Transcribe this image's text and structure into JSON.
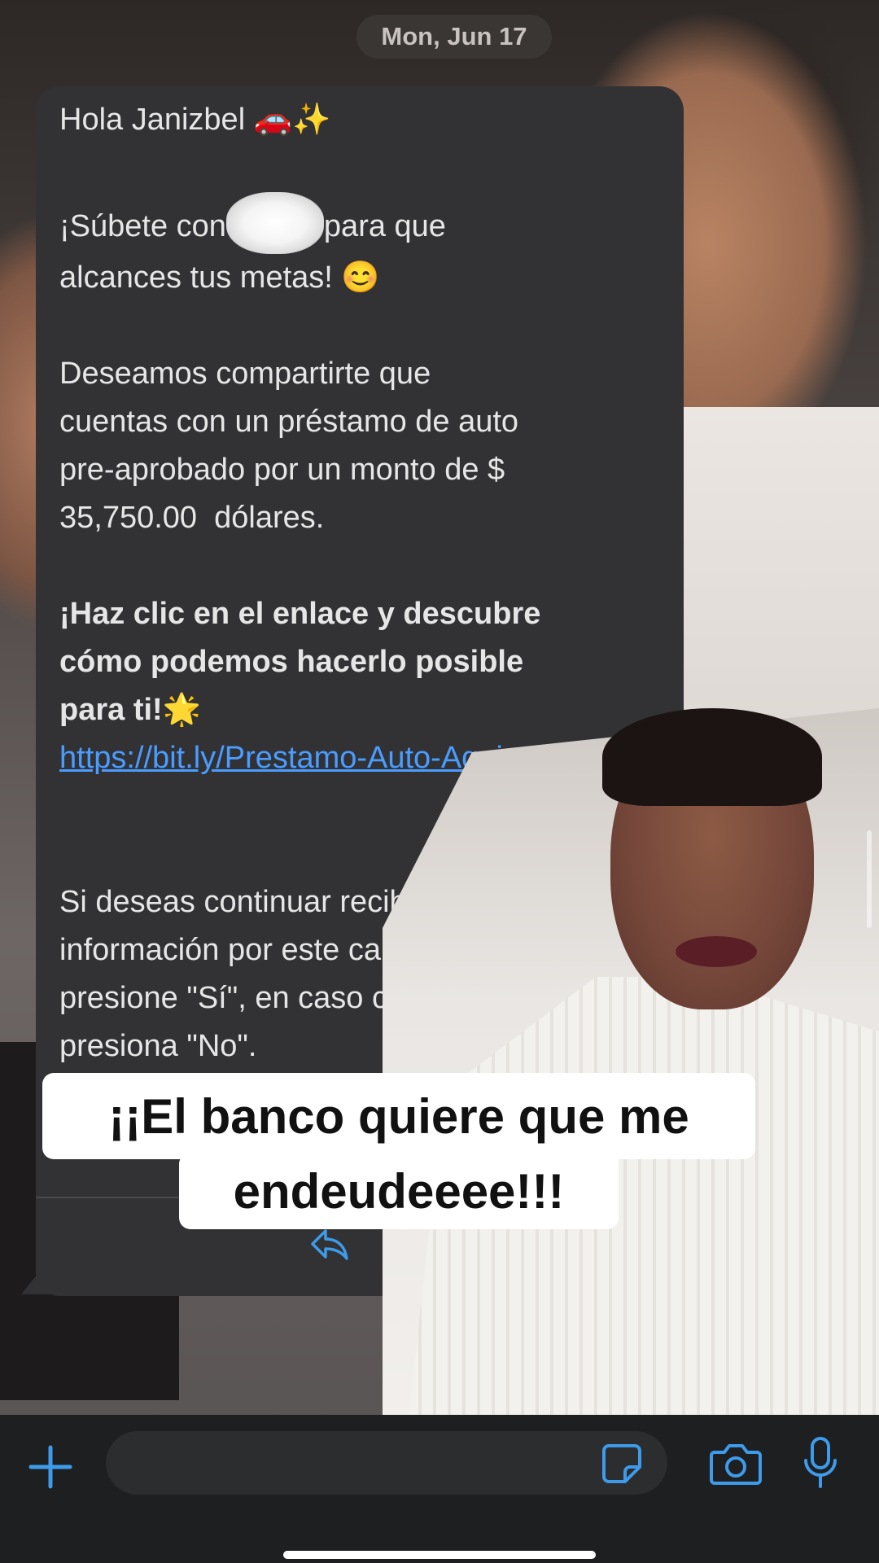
{
  "date_label": "Mon, Jun 17",
  "message": {
    "greeting": "Hola Janizbel 🚗✨",
    "line1_before": "¡Súbete con",
    "line1_after": "para que",
    "line2": "alcances tus metas! 😊",
    "para2_l1": "Deseamos compartirte que",
    "para2_l2": "cuentas con un préstamo de auto",
    "para2_l3": "pre-aprobado por un monto de $",
    "para2_l4": "35,750.00  dólares.",
    "cta_l1": "¡Haz clic en el enlace y descubre",
    "cta_l2": "cómo podemos hacerlo posible",
    "cta_l3": "para ti!🌟",
    "link": "https://bit.ly/Prestamo-Auto-Aqui",
    "para4_l1": "Si deseas continuar recibiendo",
    "para4_l2": "información por este canal",
    "para4_l3": "presione \"Sí\", en caso contrario",
    "para4_l4": "presiona \"No\"."
  },
  "caption": {
    "line1": "¡¡El banco quiere que me",
    "line2": "endeudeeee!!!"
  },
  "icons": [
    "reply-icon",
    "plus-icon",
    "sticker-icon",
    "camera-icon",
    "microphone-icon"
  ],
  "colors": {
    "bubble": "#323234",
    "link": "#4a9cff",
    "accent_icons": "#3d9bea",
    "bottom_bar": "#1e1f21"
  }
}
